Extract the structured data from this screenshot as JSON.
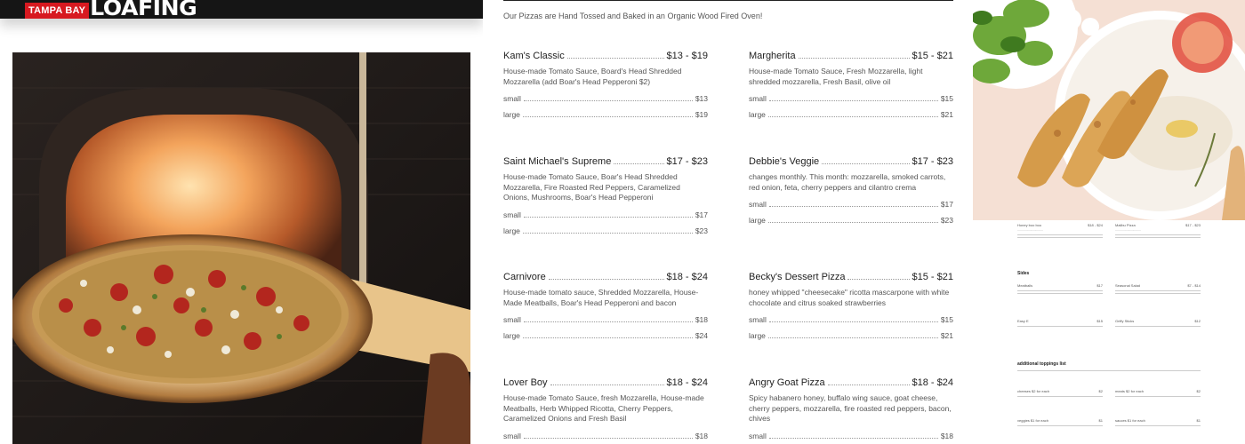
{
  "brand": {
    "badge": "TAMPA BAY",
    "wordmark": "LOAFING"
  },
  "menu": {
    "intro": "Our Pizzas are Hand Tossed and Baked in an Organic Wood Fired Oven!",
    "items": [
      {
        "name": "Kam's Classic",
        "price": "$13 - $19",
        "desc": "House-made Tomato Sauce, Board's Head Shredded Mozzarella (add Boar's Head Pepperoni $2)",
        "small": "$13",
        "large": "$19"
      },
      {
        "name": "Margherita",
        "price": "$15 - $21",
        "desc": "House-made Tomato Sauce, Fresh Mozzarella, light shredded mozzarella, Fresh Basil, olive oil",
        "small": "$15",
        "large": "$21"
      },
      {
        "name": "Saint Michael's Supreme",
        "price": "$17 - $23",
        "desc": "House-made Tomato Sauce, Boar's Head Shredded Mozzarella, Fire Roasted Red Peppers, Caramelized Onions, Mushrooms, Boar's Head Pepperoni",
        "small": "$17",
        "large": "$23"
      },
      {
        "name": "Debbie's Veggie",
        "price": "$17 - $23",
        "desc": "changes monthly. This month: mozzarella, smoked carrots, red onion, feta, cherry peppers and cilantro crema",
        "small": "$17",
        "large": "$23"
      },
      {
        "name": "Carnivore",
        "price": "$18 - $24",
        "desc": "House-made tomato sauce, Shredded Mozzarella, House-Made Meatballs, Boar's Head Pepperoni and bacon",
        "small": "$18",
        "large": "$24"
      },
      {
        "name": "Becky's Dessert Pizza",
        "price": "$15 - $21",
        "desc": "honey whipped \"cheesecake\" ricotta mascarpone with white chocolate and citrus soaked strawberries",
        "small": "$15",
        "large": "$21"
      },
      {
        "name": "Lover Boy",
        "price": "$18 - $24",
        "desc": "House-made Tomato Sauce, fresh Mozzarella, House-made Meatballs, Herb Whipped Ricotta, Cherry Peppers, Caramelized Onions and Fresh Basil",
        "small": "$18",
        "large": ""
      },
      {
        "name": "Angry Goat Pizza",
        "price": "$18 - $24",
        "desc": "Spicy habanero honey, buffalo wing sauce, goat cheese, cherry peppers, mozzarella, fire roasted red peppers, bacon, chives",
        "small": "$18",
        "large": ""
      }
    ],
    "size_small": "small",
    "size_large": "large"
  },
  "mini_menu": {
    "row1": [
      {
        "name": "Honey boo boo",
        "price": "$18 - $24"
      },
      {
        "name": "Malibu Pizza",
        "price": "$17 - $23"
      }
    ],
    "sides_title": "Sides",
    "sides": [
      {
        "name": "Meatballs",
        "price": "$17"
      },
      {
        "name": "Seasonal Salad",
        "price": "$7 - $14"
      },
      {
        "name": "Easy E",
        "price": "$15"
      },
      {
        "name": "Griffy Sticks",
        "price": "$12"
      }
    ],
    "toppings_title": "additional toppings list",
    "toppings": [
      {
        "name": "cheeses $2 for each",
        "price": "$2"
      },
      {
        "name": "meats $2 for each",
        "price": "$2"
      },
      {
        "name": "veggies $1 for each",
        "price": "$1"
      },
      {
        "name": "sauces $1 for each",
        "price": "$1"
      }
    ]
  },
  "colors": {
    "badge": "#d71920",
    "topbar": "#151515"
  },
  "icons": [
    "pizza-oven-photo",
    "food-plate-photo"
  ]
}
